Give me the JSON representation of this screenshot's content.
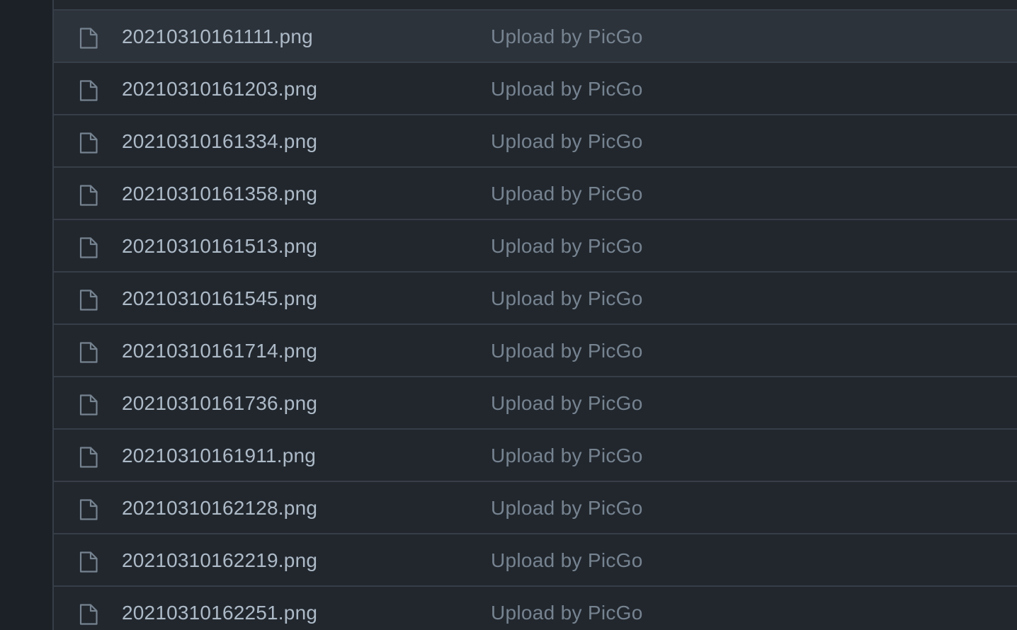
{
  "files": [
    {
      "name": "20210310161111.png",
      "message": "Upload by PicGo",
      "icon": "file-icon",
      "hovered": true
    },
    {
      "name": "20210310161203.png",
      "message": "Upload by PicGo",
      "icon": "file-icon"
    },
    {
      "name": "20210310161334.png",
      "message": "Upload by PicGo",
      "icon": "file-icon"
    },
    {
      "name": "20210310161358.png",
      "message": "Upload by PicGo",
      "icon": "file-icon"
    },
    {
      "name": "20210310161513.png",
      "message": "Upload by PicGo",
      "icon": "file-icon"
    },
    {
      "name": "20210310161545.png",
      "message": "Upload by PicGo",
      "icon": "file-icon"
    },
    {
      "name": "20210310161714.png",
      "message": "Upload by PicGo",
      "icon": "file-icon"
    },
    {
      "name": "20210310161736.png",
      "message": "Upload by PicGo",
      "icon": "file-icon"
    },
    {
      "name": "20210310161911.png",
      "message": "Upload by PicGo",
      "icon": "file-icon"
    },
    {
      "name": "20210310162128.png",
      "message": "Upload by PicGo",
      "icon": "file-icon"
    },
    {
      "name": "20210310162219.png",
      "message": "Upload by PicGo",
      "icon": "file-icon"
    },
    {
      "name": "20210310162251.png",
      "message": "Upload by PicGo",
      "icon": "file-icon"
    }
  ],
  "colors": {
    "background": "#22272e",
    "row_hover": "#2d333b",
    "border": "#373e47",
    "file_name": "#adbac7",
    "commit_message": "#768390",
    "icon": "#768390"
  }
}
